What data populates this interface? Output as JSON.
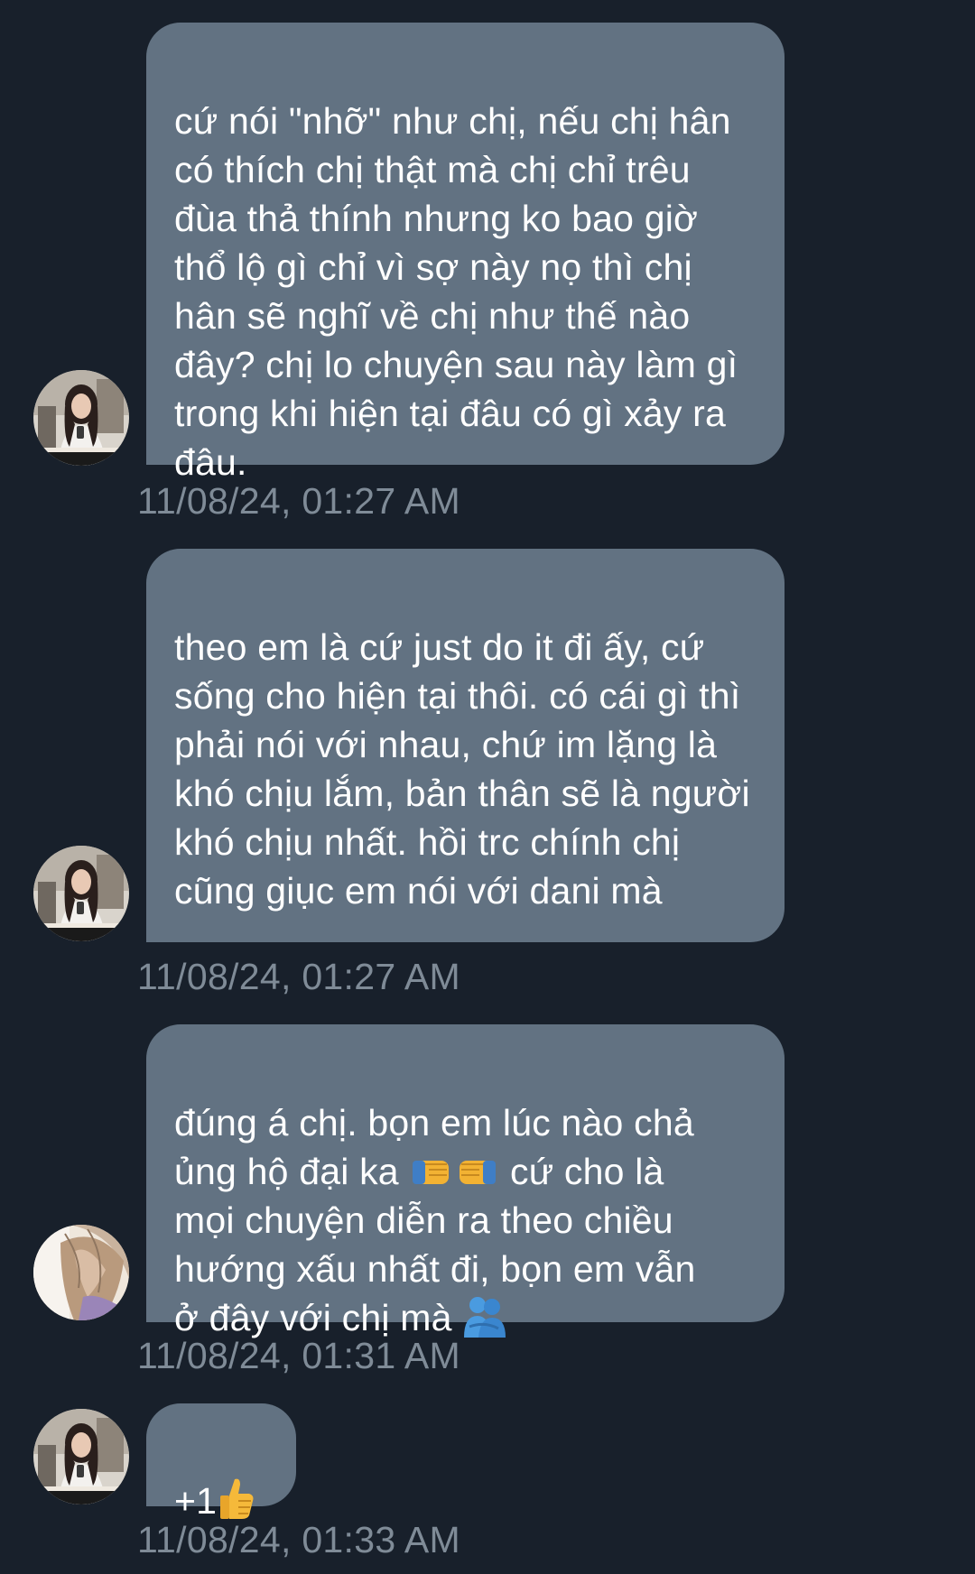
{
  "messages": [
    {
      "avatar": "user-a-avatar",
      "text": "cứ nói \"nhỡ\" như chị, nếu chị hân có thích chị thật mà chị chỉ trêu đùa thả thính nhưng ko bao giờ thổ lộ gì chỉ vì sợ này nọ thì chị hân sẽ nghĩ về chị như thế nào đây? chị lo chuyện sau này làm gì trong khi hiện tại đâu có gì xảy ra đâu.",
      "timestamp": "11/08/24, 01:27 AM"
    },
    {
      "avatar": "user-a-avatar",
      "text": "theo em là cứ just do it đi ấy, cứ sống cho hiện tại thôi. có cái gì thì phải nói với nhau, chứ im lặng là khó chịu lắm, bản thân sẽ là người khó chịu nhất. hồi trc chính chị cũng giục em nói với dani mà",
      "timestamp": "11/08/24, 01:27 AM"
    },
    {
      "avatar": "user-b-avatar",
      "text_part1": "đúng á chị. bọn em lúc nào chả\nủng hộ đại ka ",
      "text_part2": " cứ cho là\nmọi chuyện diễn ra theo chiều\nhướng xấu nhất đi, bọn em vẫn\nở đây với chị mà ",
      "emoji1": "fist-bump-emoji",
      "emoji2": "people-hugging-emoji",
      "timestamp": "11/08/24, 01:31 AM"
    },
    {
      "avatar": "user-a-avatar",
      "text": "+1",
      "emoji": "thumbs-up-emoji",
      "timestamp": "11/08/24, 01:33 AM"
    }
  ],
  "colors": {
    "background": "#18202b",
    "bubble": "#627282",
    "timestamp": "#7f8b97",
    "text": "#ffffff"
  }
}
